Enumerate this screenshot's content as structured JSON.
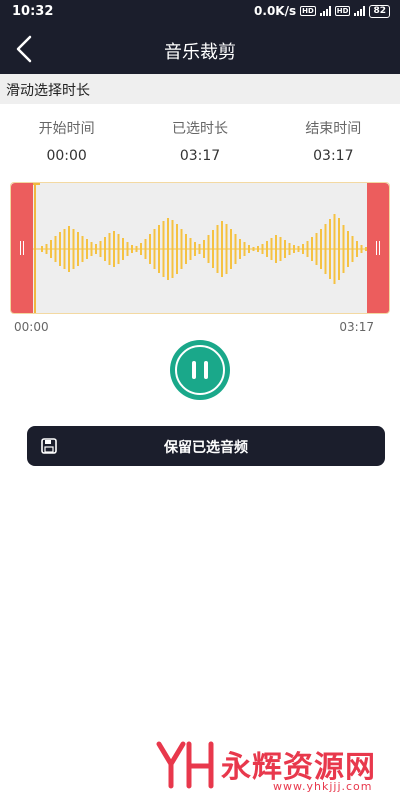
{
  "status": {
    "time": "10:32",
    "speed": "0.0K/s",
    "network": "4G",
    "battery": "82"
  },
  "header": {
    "title": "音乐裁剪",
    "back_icon": "chevron-left-icon"
  },
  "hint": "滑动选择时长",
  "info": {
    "start_label": "开始时间",
    "start_value": "00:00",
    "selected_label": "已选时长",
    "selected_value": "03:17",
    "end_label": "结束时间",
    "end_value": "03:17"
  },
  "waveform": {
    "start_time": "00:00",
    "end_time": "03:17",
    "colors": {
      "wave": "#f5c242",
      "handle": "#ec5d5d",
      "background": "#eeeeee"
    }
  },
  "player": {
    "pause_icon": "pause-icon",
    "accent": "#1aa88a"
  },
  "save_button": {
    "label": "保留已选音频",
    "icon": "save-icon"
  },
  "watermark": {
    "brand": "永辉资源网",
    "url": "www.yhkjjj.com"
  }
}
